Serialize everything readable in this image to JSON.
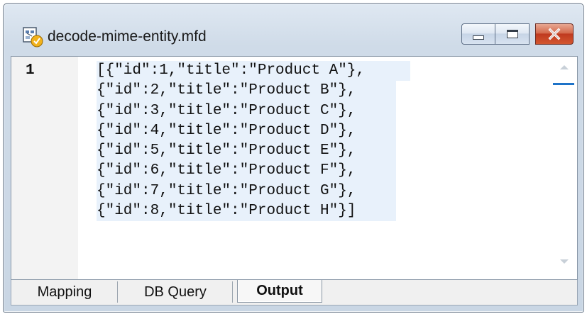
{
  "window": {
    "title": "decode-mime-entity.mfd",
    "icon": "mapforce-document-icon"
  },
  "caption_buttons": {
    "minimize": "minimize-icon",
    "maximize": "maximize-icon",
    "close": "close-icon"
  },
  "editor": {
    "line_numbers": [
      "1"
    ],
    "lines": [
      "[{\"id\":1,\"title\":\"Product A\"},",
      "{\"id\":2,\"title\":\"Product B\"},",
      "{\"id\":3,\"title\":\"Product C\"},",
      "{\"id\":4,\"title\":\"Product D\"},",
      "{\"id\":5,\"title\":\"Product E\"},",
      "{\"id\":6,\"title\":\"Product F\"},",
      "{\"id\":7,\"title\":\"Product G\"},",
      "{\"id\":8,\"title\":\"Product H\"}]"
    ],
    "selection_color": "#e8f1fb"
  },
  "tabs": [
    {
      "label": "Mapping",
      "active": false
    },
    {
      "label": "DB Query",
      "active": false
    },
    {
      "label": "Output",
      "active": true
    }
  ],
  "colors": {
    "close_button": "#c9472a",
    "scroll_marker": "#1e73c8"
  }
}
